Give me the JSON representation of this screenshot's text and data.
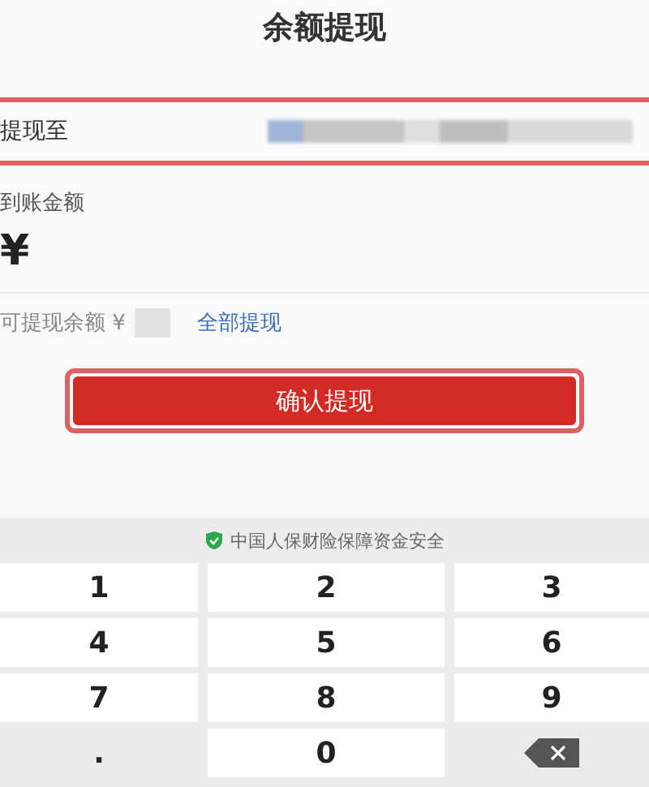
{
  "title": "余额提现",
  "withdraw_to": {
    "label": "提现至",
    "highlighted": true
  },
  "amount": {
    "label": "到账金额",
    "currency": "¥"
  },
  "balance": {
    "label": "可提现余额 ¥",
    "link": "全部提现"
  },
  "confirm_button": {
    "label": "确认提现",
    "highlighted": true
  },
  "security_note": "中国人保财险保障资金安全",
  "keypad": [
    {
      "kind": "digit",
      "label": "1"
    },
    {
      "kind": "digit",
      "label": "2"
    },
    {
      "kind": "digit",
      "label": "3"
    },
    {
      "kind": "digit",
      "label": "4"
    },
    {
      "kind": "digit",
      "label": "5"
    },
    {
      "kind": "digit",
      "label": "6"
    },
    {
      "kind": "digit",
      "label": "7"
    },
    {
      "kind": "digit",
      "label": "8"
    },
    {
      "kind": "digit",
      "label": "9"
    },
    {
      "kind": "dot",
      "label": "."
    },
    {
      "kind": "digit",
      "label": "0"
    },
    {
      "kind": "delete"
    }
  ]
}
